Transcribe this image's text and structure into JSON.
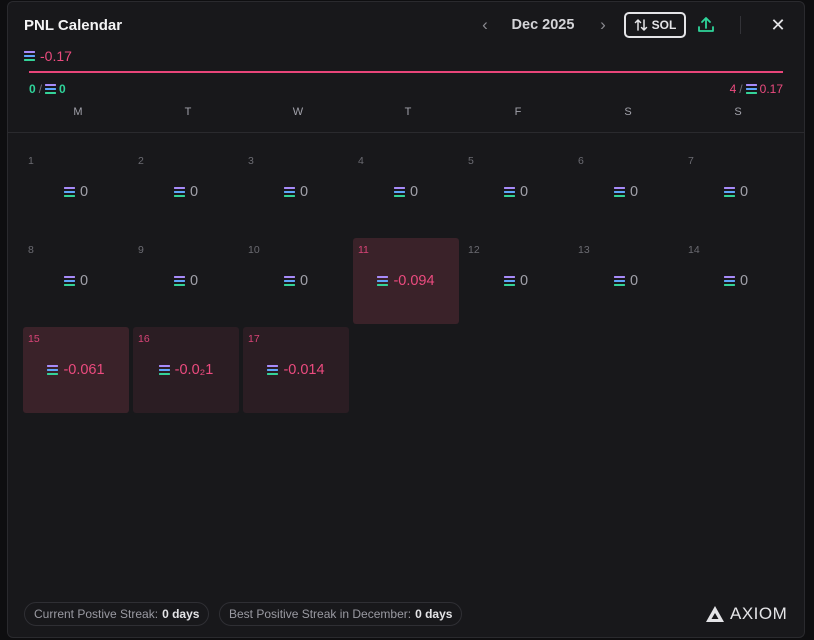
{
  "header": {
    "title": "PNL Calendar",
    "month": "Dec 2025",
    "prev_icon": "chevron-left-icon",
    "next_icon": "chevron-right-icon",
    "currency_toggle": "SOL",
    "close_label": "✕"
  },
  "summary": {
    "total": "-0.17",
    "positive_count": "0",
    "positive_sep": "/",
    "positive_sum": "0",
    "negative_count": "4",
    "negative_sep": "/",
    "negative_sum": "0.17"
  },
  "weekdays": [
    "M",
    "T",
    "W",
    "T",
    "F",
    "S",
    "S"
  ],
  "days": [
    {
      "n": "1",
      "v": "0",
      "s": ""
    },
    {
      "n": "2",
      "v": "0",
      "s": ""
    },
    {
      "n": "3",
      "v": "0",
      "s": ""
    },
    {
      "n": "4",
      "v": "0",
      "s": ""
    },
    {
      "n": "5",
      "v": "0",
      "s": ""
    },
    {
      "n": "6",
      "v": "0",
      "s": ""
    },
    {
      "n": "7",
      "v": "0",
      "s": ""
    },
    {
      "n": "8",
      "v": "0",
      "s": ""
    },
    {
      "n": "9",
      "v": "0",
      "s": ""
    },
    {
      "n": "10",
      "v": "0",
      "s": ""
    },
    {
      "n": "11",
      "v": "-0.094",
      "s": "neg strong"
    },
    {
      "n": "12",
      "v": "0",
      "s": ""
    },
    {
      "n": "13",
      "v": "0",
      "s": ""
    },
    {
      "n": "14",
      "v": "0",
      "s": ""
    },
    {
      "n": "15",
      "v": "-0.061",
      "s": "neg strong"
    },
    {
      "n": "16",
      "v": "-0.0₂1",
      "s": "neg"
    },
    {
      "n": "17",
      "v": "-0.014",
      "s": "neg"
    }
  ],
  "footer": {
    "current_streak_label": "Current Postive Streak:",
    "current_streak_value": "0 days",
    "best_streak_label": "Best Positive Streak in December:",
    "best_streak_value": "0 days",
    "brand": "AXIOM"
  },
  "colors": {
    "negative": "#ec4b7f",
    "positive": "#2fd59b",
    "background": "#18181b"
  }
}
